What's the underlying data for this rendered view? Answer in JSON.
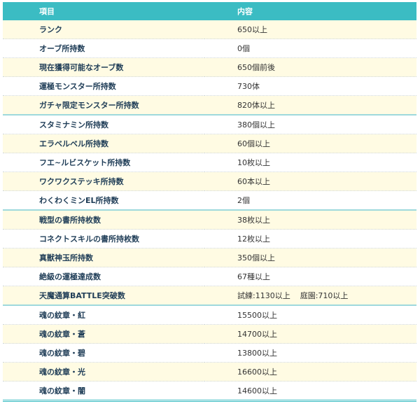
{
  "table": {
    "headers": [
      "項目",
      "内容"
    ],
    "rows": [
      {
        "item": "ランク",
        "content": "650以上"
      },
      {
        "item": "オーブ所持数",
        "content": "0個"
      },
      {
        "item": "現在獲得可能なオーブ数",
        "content": "650個前後"
      },
      {
        "item": "運極モンスター所持数",
        "content": "730体"
      },
      {
        "item": "ガチャ限定モンスター所持数",
        "content": "820体以上"
      },
      {
        "item": "スタミナミン所持数",
        "content": "380個以上"
      },
      {
        "item": "エラベルベル所持数",
        "content": "60個以上"
      },
      {
        "item": "フエ~ルビスケット所持数",
        "content": "10枚以上"
      },
      {
        "item": "ワクワクステッキ所持数",
        "content": "60本以上"
      },
      {
        "item": "わくわくミンEL所持数",
        "content": "2個"
      },
      {
        "item": "戦型の書所持枚数",
        "content": "38枚以上"
      },
      {
        "item": "コネクトスキルの書所持枚数",
        "content": "12枚以上"
      },
      {
        "item": "真獣神玉所持数",
        "content": "350個以上"
      },
      {
        "item": "絶級の運極達成数",
        "content": "67種以上"
      },
      {
        "item": "天魔通算BATTLE突破数",
        "content_parts": [
          "試練:1130以上",
          "庭園:710以上"
        ]
      },
      {
        "item": "魂の紋章・紅",
        "content": "15500以上"
      },
      {
        "item": "魂の紋章・蒼",
        "content": "14700以上"
      },
      {
        "item": "魂の紋章・碧",
        "content": "13800以上"
      },
      {
        "item": "魂の紋章・光",
        "content": "16600以上"
      },
      {
        "item": "魂の紋章・闇",
        "content": "14600以上"
      }
    ]
  },
  "colors": {
    "header_bg": "#3bbcc3",
    "header_text": "#ffffff",
    "stripe_bg": "#fffbe3",
    "item_text": "#1f3d57",
    "group_divider": "#9ed9dc"
  }
}
